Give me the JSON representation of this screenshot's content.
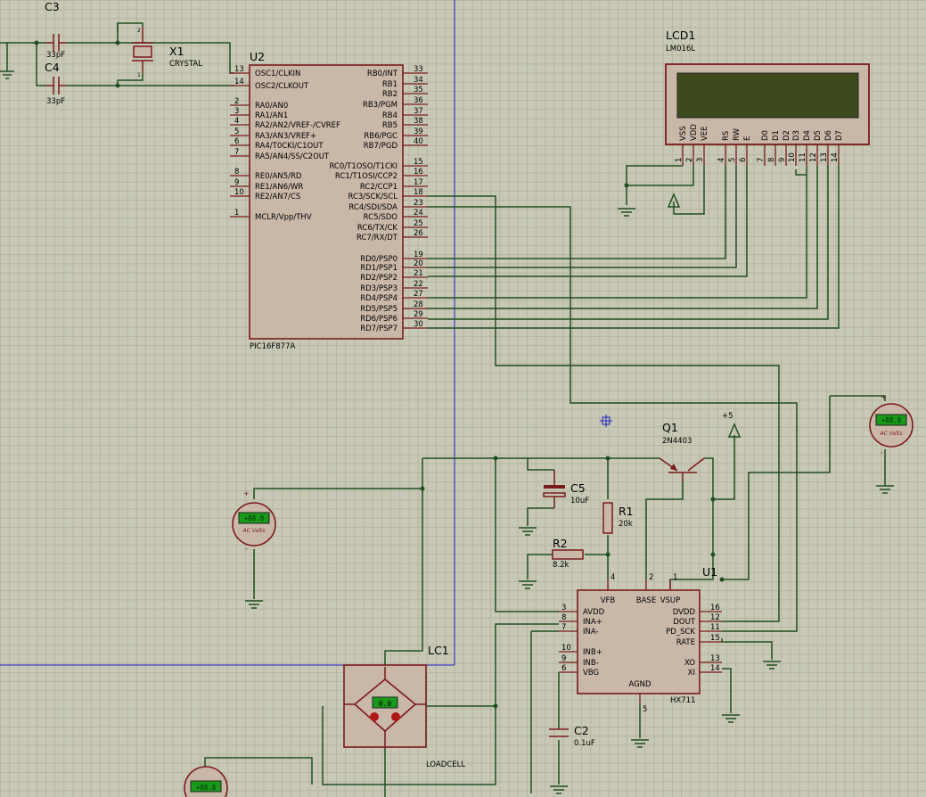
{
  "u2": {
    "ref": "U2",
    "part": "PIC16F877A",
    "left_pins": [
      {
        "num": "13",
        "label": "OSC1/CLKIN"
      },
      {
        "num": "14",
        "label": "OSC2/CLKOUT"
      },
      {
        "num": "2",
        "label": "RA0/AN0"
      },
      {
        "num": "3",
        "label": "RA1/AN1"
      },
      {
        "num": "4",
        "label": "RA2/AN2/VREF-/CVREF"
      },
      {
        "num": "5",
        "label": "RA3/AN3/VREF+"
      },
      {
        "num": "6",
        "label": "RA4/T0CKI/C1OUT"
      },
      {
        "num": "7",
        "label": "RA5/AN4/SS/C2OUT"
      },
      {
        "num": "8",
        "label": "RE0/AN5/RD"
      },
      {
        "num": "9",
        "label": "RE1/AN6/WR"
      },
      {
        "num": "10",
        "label": "RE2/AN7/CS"
      },
      {
        "num": "1",
        "label": "MCLR/Vpp/THV"
      }
    ],
    "right_pins": [
      {
        "num": "33",
        "label": "RB0/INT"
      },
      {
        "num": "34",
        "label": "RB1"
      },
      {
        "num": "35",
        "label": "RB2"
      },
      {
        "num": "36",
        "label": "RB3/PGM"
      },
      {
        "num": "37",
        "label": "RB4"
      },
      {
        "num": "38",
        "label": "RB5"
      },
      {
        "num": "39",
        "label": "RB6/PGC"
      },
      {
        "num": "40",
        "label": "RB7/PGD"
      },
      {
        "num": "15",
        "label": "RC0/T1OSO/T1CKI"
      },
      {
        "num": "16",
        "label": "RC1/T1OSI/CCP2"
      },
      {
        "num": "17",
        "label": "RC2/CCP1"
      },
      {
        "num": "18",
        "label": "RC3/SCK/SCL"
      },
      {
        "num": "23",
        "label": "RC4/SDI/SDA"
      },
      {
        "num": "24",
        "label": "RC5/SDO"
      },
      {
        "num": "25",
        "label": "RC6/TX/CK"
      },
      {
        "num": "26",
        "label": "RC7/RX/DT"
      },
      {
        "num": "19",
        "label": "RD0/PSP0"
      },
      {
        "num": "20",
        "label": "RD1/PSP1"
      },
      {
        "num": "21",
        "label": "RD2/PSP2"
      },
      {
        "num": "22",
        "label": "RD3/PSP3"
      },
      {
        "num": "27",
        "label": "RD4/PSP4"
      },
      {
        "num": "28",
        "label": "RD5/PSP5"
      },
      {
        "num": "29",
        "label": "RD6/PSP6"
      },
      {
        "num": "30",
        "label": "RD7/PSP7"
      }
    ]
  },
  "lcd1": {
    "ref": "LCD1",
    "part": "LM016L",
    "pins": [
      {
        "num": "1",
        "label": "VSS"
      },
      {
        "num": "2",
        "label": "VDD"
      },
      {
        "num": "3",
        "label": "VEE"
      },
      {
        "num": "4",
        "label": "RS"
      },
      {
        "num": "5",
        "label": "RW"
      },
      {
        "num": "6",
        "label": "E"
      },
      {
        "num": "7",
        "label": "D0"
      },
      {
        "num": "8",
        "label": "D1"
      },
      {
        "num": "9",
        "label": "D2"
      },
      {
        "num": "10",
        "label": "D3"
      },
      {
        "num": "11",
        "label": "D4"
      },
      {
        "num": "12",
        "label": "D5"
      },
      {
        "num": "13",
        "label": "D6"
      },
      {
        "num": "14",
        "label": "D7"
      }
    ]
  },
  "u1": {
    "ref": "U1",
    "part": "HX711",
    "top_pins": [
      {
        "num": "4",
        "label": "VFB"
      },
      {
        "num": "2",
        "label": "BASE"
      },
      {
        "num": "1",
        "label": "VSUP"
      }
    ],
    "left_pins": [
      {
        "num": "3",
        "label": "AVDD"
      },
      {
        "num": "8",
        "label": "INA+"
      },
      {
        "num": "7",
        "label": "INA-"
      },
      {
        "num": "10",
        "label": "INB+"
      },
      {
        "num": "9",
        "label": "INB-"
      },
      {
        "num": "6",
        "label": "VBG"
      }
    ],
    "right_pins": [
      {
        "num": "16",
        "label": "DVDD"
      },
      {
        "num": "12",
        "label": "DOUT"
      },
      {
        "num": "11",
        "label": "PD_SCK"
      },
      {
        "num": "15",
        "label": "RATE"
      },
      {
        "num": "13",
        "label": "XO"
      },
      {
        "num": "14",
        "label": "XI"
      }
    ],
    "bottom_pin": {
      "num": "5",
      "label": "AGND"
    }
  },
  "components": {
    "c3": {
      "ref": "C3",
      "value": "33pF"
    },
    "c4": {
      "ref": "C4",
      "value": "33pF"
    },
    "x1": {
      "ref": "X1",
      "value": "CRYSTAL",
      "pin1": "1",
      "pin2": "2"
    },
    "q1": {
      "ref": "Q1",
      "value": "2N4403"
    },
    "c5": {
      "ref": "C5",
      "value": "10uF"
    },
    "r1": {
      "ref": "R1",
      "value": "20k"
    },
    "r2": {
      "ref": "R2",
      "value": "8.2k"
    },
    "c2": {
      "ref": "C2",
      "value": "0.1uF"
    },
    "lc1": {
      "ref": "LC1",
      "value": "LOADCELL",
      "display": "0.0"
    },
    "supply": {
      "label": "+5"
    }
  },
  "voltmeters": [
    {
      "display": "+88.8",
      "mode": "AC Volts",
      "plus": "+",
      "minus": "-"
    },
    {
      "display": "+88.8",
      "mode": "AC Volts",
      "plus": "+",
      "minus": "-"
    },
    {
      "display": "+88.8"
    }
  ],
  "colors": {
    "background": "#c8c8b6",
    "grid": "#b4b4a0",
    "component": "#7a1a1a",
    "body_fill": "#c9b7a8",
    "wire": "#1f4f1f",
    "lcd_screen": "#3e4a1c",
    "meter_display": "#1a9a1a",
    "boundary": "#2020c0"
  }
}
